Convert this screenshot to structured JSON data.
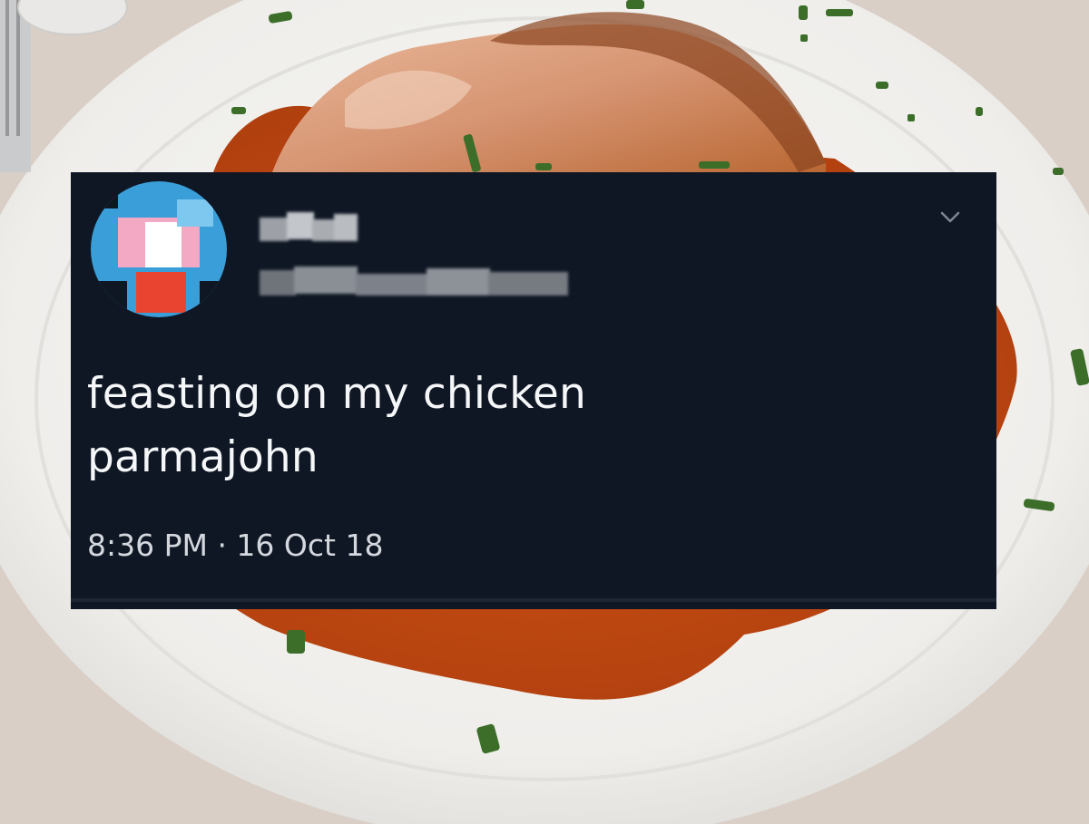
{
  "tweet": {
    "text": "feasting on my chicken parmajohn",
    "timestamp": "8:36 PM · 16 Oct 18",
    "avatar_colors": [
      "#3a9ed9",
      "#f3a9c4",
      "#ffffff",
      "#e8442f"
    ],
    "name_pixel_color": "#b9bcc1",
    "handle_pixel_color": "#7d828a",
    "menu_icon": "chevron-down-icon",
    "card_background": "#0f1724",
    "text_color": "#f4f6f8",
    "timestamp_color": "#d4d8de"
  },
  "photo": {
    "plate_color": "#f2f1ef",
    "sauce_color": "#c54a12",
    "herb_color": "#3c6e2a",
    "cheese_color": "#dba07e",
    "tablecloth_color": "#d9cfc7"
  }
}
